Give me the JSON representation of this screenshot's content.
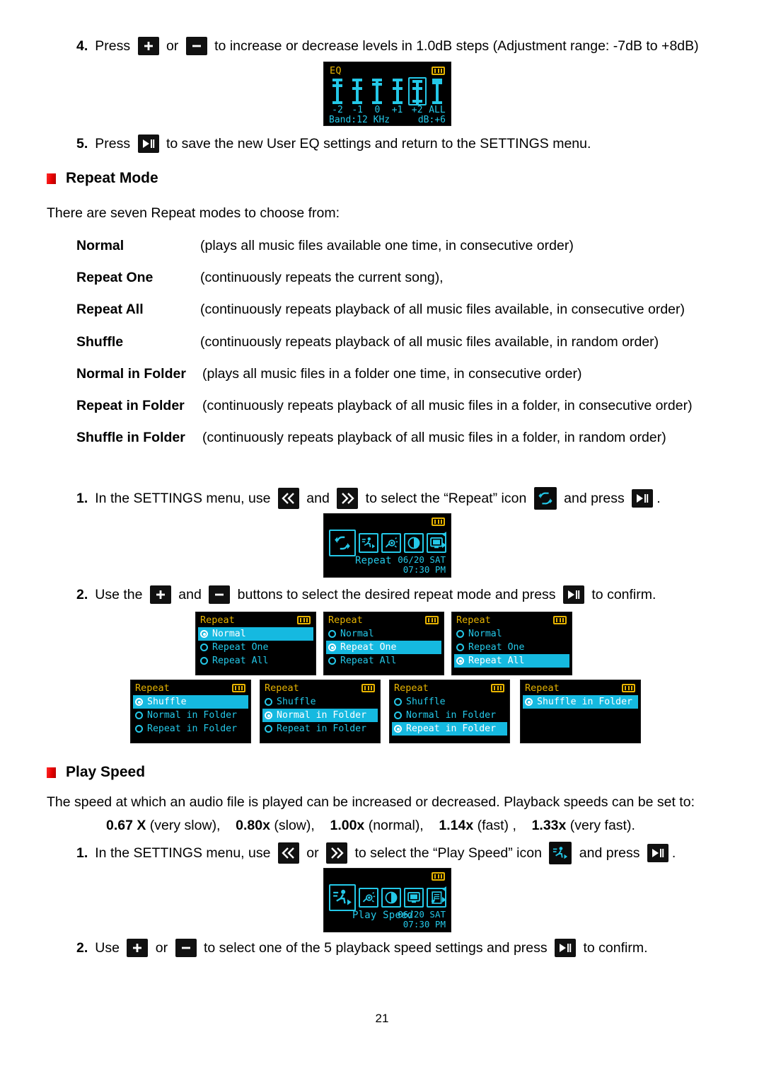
{
  "page": {
    "number": "21"
  },
  "steps": {
    "eq_step4": {
      "num": "4.",
      "a": "Press ",
      "b": " or ",
      "c": " to increase or decrease levels in 1.0dB steps (Adjustment range: -7dB to +8dB)"
    },
    "eq_step5": {
      "num": "5.",
      "a": "Press ",
      "b": " to save the new User EQ settings and return to the SETTINGS menu."
    },
    "repeat_step1": {
      "num": "1.",
      "a": "In the SETTINGS menu, use ",
      "b": " and ",
      "c": " to select the “Repeat” icon ",
      "d": " and press ",
      "e": "."
    },
    "repeat_step2": {
      "num": "2.",
      "a": "Use the ",
      "b": " and ",
      "c": " buttons to select the desired repeat mode and press ",
      "d": " to confirm."
    },
    "speed_step1": {
      "num": "1.",
      "a": "In the SETTINGS menu, use ",
      "b": " or ",
      "c": " to select the “Play Speed” icon ",
      "d": " and press ",
      "e": "."
    },
    "speed_step2": {
      "num": "2.",
      "a": "Use ",
      "b": " or ",
      "c": " to select one of the 5 playback speed settings and press ",
      "d": " to confirm."
    }
  },
  "sections": {
    "repeat_mode": {
      "heading": "Repeat Mode",
      "intro": "There are seven Repeat modes to choose from:",
      "modes": [
        {
          "term": "Normal",
          "desc": "(plays all music files available one time, in consecutive order)"
        },
        {
          "term": "Repeat One",
          "desc": "(continuously repeats the current song),"
        },
        {
          "term": "Repeat All",
          "desc": "(continuously repeats playback of all music files available, in consecutive order)"
        },
        {
          "term": "Shuffle",
          "desc": "(continuously repeats playback of all music files available, in random order)"
        },
        {
          "term": "Normal in Folder",
          "desc": "(plays all music files in a folder one time, in consecutive order)"
        },
        {
          "term": "Repeat in Folder",
          "desc": "(continuously repeats playback of all music files in a folder, in consecutive order)"
        },
        {
          "term": "Shuffle in Folder",
          "desc": "(continuously repeats playback of all music files in a folder, in random order)"
        }
      ]
    },
    "play_speed": {
      "heading": "Play Speed",
      "intro": "The speed at which an audio file is played can be increased or decreased. Playback speeds can be set to:",
      "speeds_line": "0.67 X (very slow),    0.80x (slow),    1.00x (normal),    1.14x (fast) ,  1.33x (very fast).",
      "speed_values": [
        {
          "value": "0.67 X",
          "label": "(very slow),"
        },
        {
          "value": "0.80x",
          "label": "(slow),"
        },
        {
          "value": "1.00x",
          "label": "(normal),"
        },
        {
          "value": "1.14x",
          "label": "(fast) ,"
        },
        {
          "value": "1.33x",
          "label": "(very fast)."
        }
      ]
    }
  },
  "eq_screen": {
    "title": "EQ",
    "scale": [
      "-2",
      "-1",
      "0",
      "+1",
      "+2",
      "ALL"
    ],
    "band_label": "Band:12 KHz",
    "db_label": "dB:+6",
    "selected_index": 4,
    "sliders": [
      {
        "pos": 0.32
      },
      {
        "pos": 0.46
      },
      {
        "pos": 0.22
      },
      {
        "pos": 0.48
      },
      {
        "pos": 0.38
      },
      {
        "pos": 0.14
      }
    ]
  },
  "settings_menu_repeat": {
    "label": "Repeat",
    "date": "06/20 SAT",
    "time": "07:30 PM",
    "icons": [
      "repeat-icon",
      "play-speed-icon",
      "backlight-icon",
      "contrast-icon",
      "display-icon"
    ],
    "active_index": 0
  },
  "settings_menu_play_speed": {
    "label": "Play Speed",
    "date": "06/20 SAT",
    "time": "07:30 PM",
    "icons": [
      "play-speed-icon",
      "backlight-icon",
      "contrast-icon",
      "display-icon",
      "record-icon"
    ],
    "active_index": 0
  },
  "repeat_screens": [
    {
      "title": "Repeat",
      "items": [
        "Normal",
        "Repeat One",
        "Repeat All"
      ],
      "selected": 0
    },
    {
      "title": "Repeat",
      "items": [
        "Normal",
        "Repeat One",
        "Repeat All"
      ],
      "selected": 1
    },
    {
      "title": "Repeat",
      "items": [
        "Normal",
        "Repeat One",
        "Repeat All"
      ],
      "selected": 2
    },
    {
      "title": "Repeat",
      "items": [
        "Shuffle",
        "Normal in Folder",
        "Repeat in Folder"
      ],
      "selected": 0
    },
    {
      "title": "Repeat",
      "items": [
        "Shuffle",
        "Normal in Folder",
        "Repeat in Folder"
      ],
      "selected": 1
    },
    {
      "title": "Repeat",
      "items": [
        "Shuffle",
        "Normal in Folder",
        "Repeat in Folder"
      ],
      "selected": 2
    },
    {
      "title": "Repeat",
      "items": [
        "Shuffle in Folder"
      ],
      "selected": 0
    }
  ],
  "colors": {
    "lcd_cyan": "#24c8e8",
    "lcd_amber": "#e8b400",
    "lcd_highlight": "#15b9e0",
    "bullet_red": "#e60000"
  }
}
